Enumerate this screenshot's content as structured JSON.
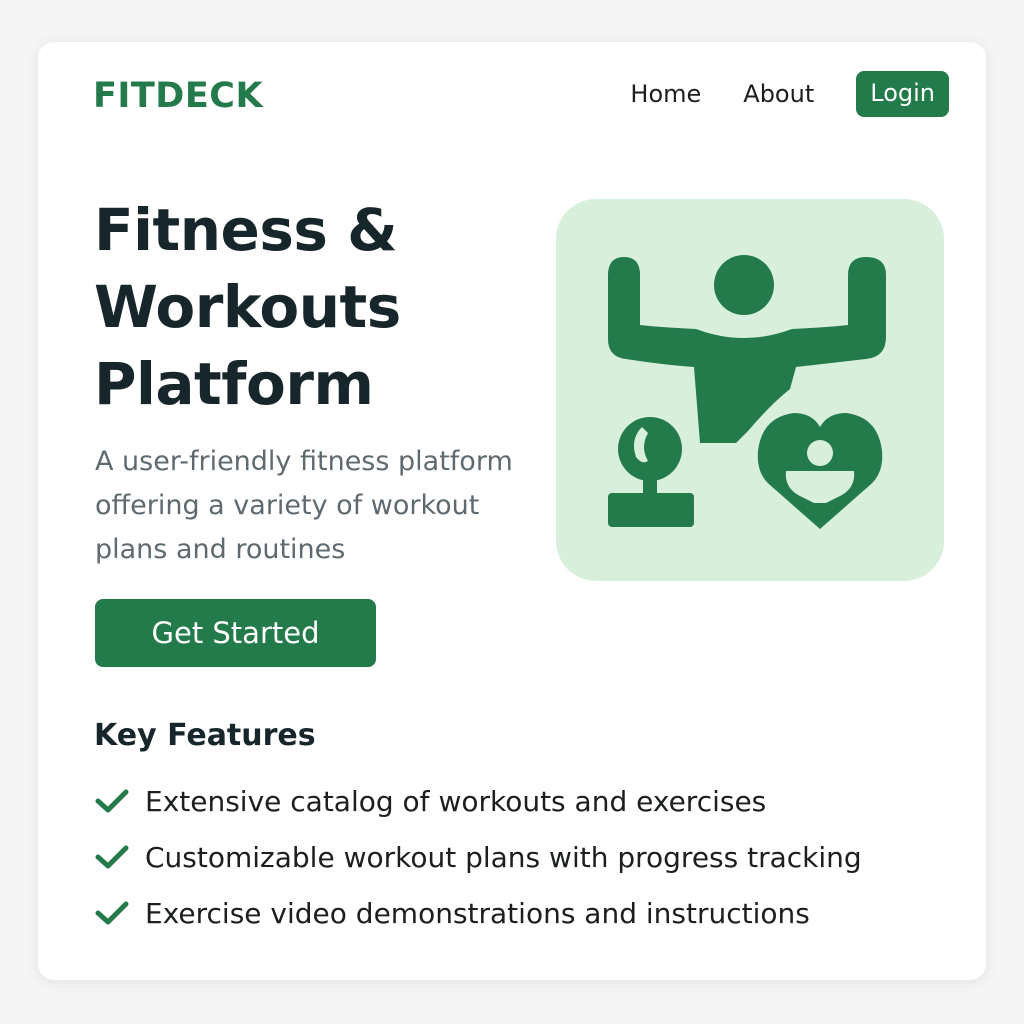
{
  "brand": {
    "name": "FITDECK"
  },
  "nav": {
    "links": [
      "Home",
      "About"
    ],
    "login_label": "Login"
  },
  "hero": {
    "title": "Fitness & Workouts Platform",
    "subtitle": "A user-friendly fitness platform offering a variety of workout plans and routines",
    "cta_label": "Get Started",
    "illustration": "fitness-illustration (flexing figure, stopwatch, heart)"
  },
  "features": {
    "title": "Key Features",
    "icon": "checkmark-icon",
    "items": [
      "Extensive catalog of workouts and exercises",
      "Customizable workout plans with progress tracking",
      "Exercise video demonstrations and instructions"
    ]
  },
  "colors": {
    "accent": "#237a4b",
    "illustration_bg": "#d7efdb",
    "heading": "#17262a",
    "muted_text": "#5e6a70",
    "page_bg": "#f4f5f4"
  }
}
